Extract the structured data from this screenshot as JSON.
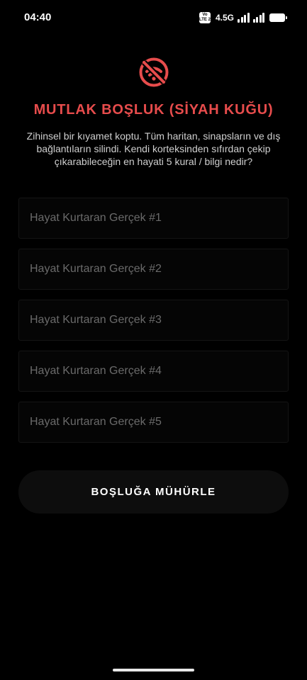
{
  "status_bar": {
    "time": "04:40",
    "volte_top": "Vo",
    "volte_bottom": "LTE 2",
    "network": "4.5G"
  },
  "header": {
    "icon": "no-signal-icon",
    "title": "MUTLAK BOŞLUK (SİYAH KUĞU)",
    "subtitle": "Zihinsel bir kıyamet koptu. Tüm haritan, sinapsların ve dış bağlantıların silindi. Kendi korteksinden sıfırdan çekip çıkarabileceğin en hayati 5 kural / bilgi nedir?"
  },
  "facts": [
    {
      "placeholder": "Hayat Kurtaran Gerçek #1",
      "value": ""
    },
    {
      "placeholder": "Hayat Kurtaran Gerçek #2",
      "value": ""
    },
    {
      "placeholder": "Hayat Kurtaran Gerçek #3",
      "value": ""
    },
    {
      "placeholder": "Hayat Kurtaran Gerçek #4",
      "value": ""
    },
    {
      "placeholder": "Hayat Kurtaran Gerçek #5",
      "value": ""
    }
  ],
  "actions": {
    "seal_label": "BOŞLUĞA MÜHÜRLE"
  },
  "colors": {
    "accent": "#e74c4c",
    "background": "#000000",
    "field_background": "#050505",
    "button_background": "#0d0d0d"
  }
}
